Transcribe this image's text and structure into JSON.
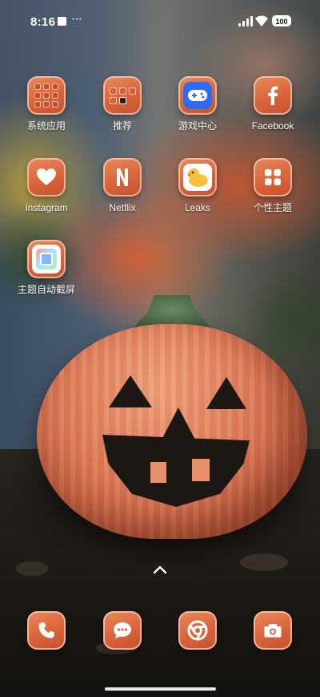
{
  "status_bar": {
    "time": "8:16",
    "more": "···",
    "battery": "100"
  },
  "apps": [
    {
      "name": "系统应用",
      "icon": "folder-icon"
    },
    {
      "name": "推荐",
      "icon": "folder-icon"
    },
    {
      "name": "游戏中心",
      "icon": "gamepad-icon"
    },
    {
      "name": "Facebook",
      "icon": "facebook-icon"
    },
    {
      "name": "Instagram",
      "icon": "heart-icon"
    },
    {
      "name": "Netflix",
      "icon": "netflix-icon"
    },
    {
      "name": "Leaks",
      "icon": "duck-icon"
    },
    {
      "name": "个性主题",
      "icon": "grid-icon"
    },
    {
      "name": "主题自动截屏",
      "icon": "screenshot-icon"
    }
  ],
  "dock": [
    {
      "icon": "phone-icon"
    },
    {
      "icon": "messages-icon"
    },
    {
      "icon": "chrome-icon"
    },
    {
      "icon": "camera-icon"
    }
  ],
  "colors": {
    "icon_accent": "#d9643a",
    "icon_border": "#ffdcc8",
    "label": "#ffffff"
  }
}
